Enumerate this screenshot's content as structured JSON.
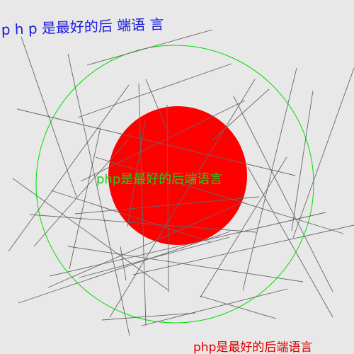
{
  "image": {
    "background_color": "#e8e8e8",
    "outer_circle_color": "#00dd00",
    "inner_disk_color": "#ff0000",
    "line_color": "#666666"
  },
  "texts": {
    "top_left": "p h p 是最好的后 端语 言",
    "center": "php是最好的后端语言",
    "bottom_right": "php是最好的后端语言"
  },
  "colors": {
    "top_left": "#1a1adc",
    "center": "#22cc22",
    "bottom_right": "#dd0000"
  }
}
